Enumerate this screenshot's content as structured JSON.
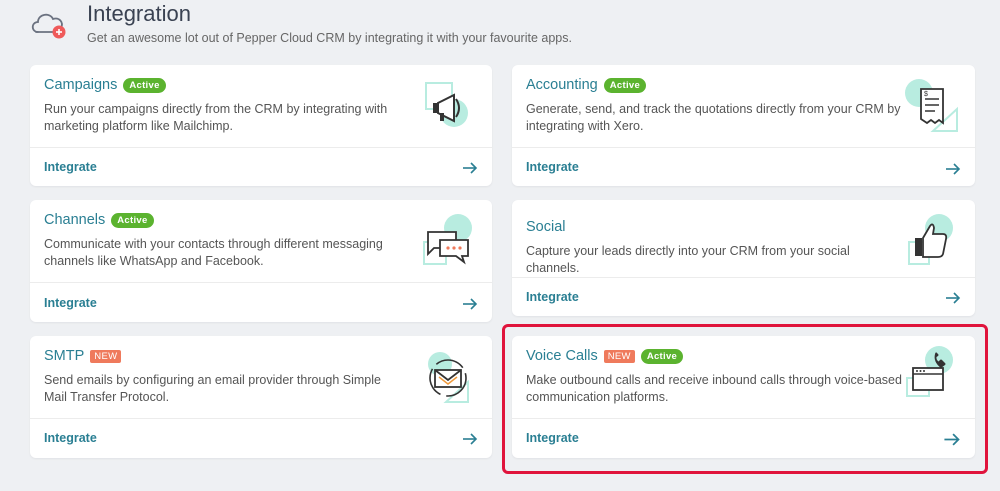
{
  "header": {
    "title": "Integration",
    "subtitle": "Get an awesome lot out of Pepper Cloud CRM by integrating it with your favourite apps."
  },
  "colors": {
    "accent": "#2a7f93",
    "active_badge": "#5bb32f",
    "new_badge": "#ef7a5c",
    "highlight": "#e0143c",
    "illustration_mint": "#b8ece0"
  },
  "cards": [
    {
      "title": "Campaigns",
      "badges": [
        "Active"
      ],
      "description": "Run your campaigns directly from the CRM by integrating with marketing platform like Mailchimp.",
      "link": "Integrate",
      "icon": "megaphone-icon"
    },
    {
      "title": "Accounting",
      "badges": [
        "Active"
      ],
      "description": "Generate, send, and track the quotations directly from your CRM by integrating with Xero.",
      "link": "Integrate",
      "icon": "receipt-icon"
    },
    {
      "title": "Channels",
      "badges": [
        "Active"
      ],
      "description": "Communicate with your contacts through different messaging channels like WhatsApp and Facebook.",
      "link": "Integrate",
      "icon": "chat-bubbles-icon"
    },
    {
      "title": "Social",
      "badges": [],
      "description": "Capture your leads directly into your CRM from your social channels.",
      "link": "Integrate",
      "icon": "thumbs-up-icon"
    },
    {
      "title": "SMTP",
      "badges": [
        "NEW"
      ],
      "description": "Send emails by configuring an email provider through Simple Mail Transfer Protocol.",
      "link": "Integrate",
      "icon": "email-icon"
    },
    {
      "title": "Voice Calls",
      "badges": [
        "NEW",
        "Active"
      ],
      "description": "Make outbound calls and receive inbound calls through voice-based communication platforms.",
      "link": "Integrate",
      "icon": "phone-browser-icon"
    }
  ]
}
